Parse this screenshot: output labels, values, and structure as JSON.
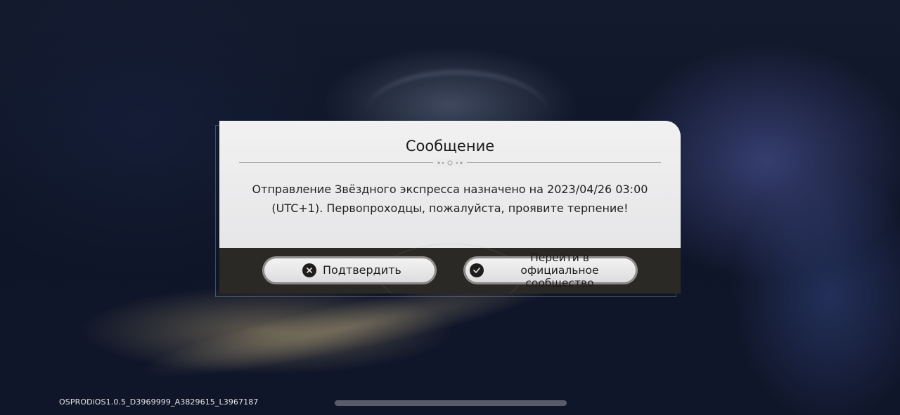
{
  "dialog": {
    "title": "Сообщение",
    "message_line1": "Отправление Звёздного экспресса назначено на 2023/04/26 03:00",
    "message_line2": "(UTC+1). Первопроходцы, пожалуйста, проявите терпение!",
    "confirm_button": {
      "label": "Подтвердить",
      "icon": "close-circle-icon"
    },
    "community_button": {
      "label": "Перейти в официальное сообщество",
      "icon": "check-circle-icon"
    }
  },
  "build_info": "OSPRODiOS1.0.5_D3969999_A3829615_L3967187",
  "colors": {
    "dialog_body": "#ececec",
    "dialog_footer": "#2b2926",
    "button_icon": "#1f1d1b",
    "background": "#10162a"
  }
}
